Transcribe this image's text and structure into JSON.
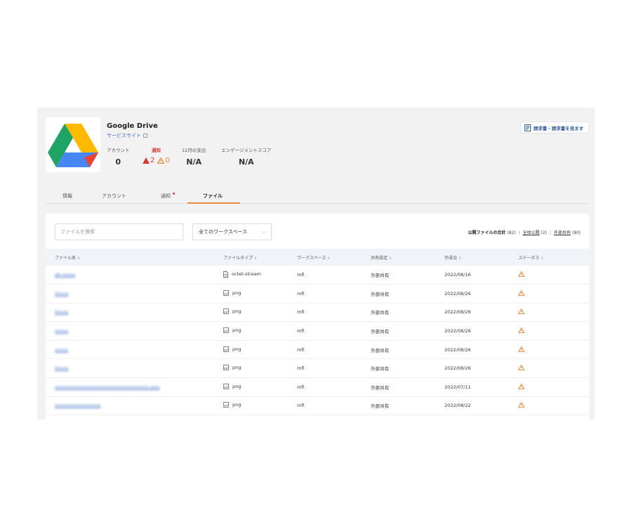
{
  "app": {
    "title": "Google Drive",
    "service_link": "サービスサイト",
    "logo": "google-drive-logo",
    "report_button": "請求書・請求書を見ます"
  },
  "stats": [
    {
      "label": "アカウント",
      "value": "0"
    },
    {
      "label": "通知",
      "alert_high": "2",
      "alert_warn": "0"
    },
    {
      "label": "12月の支出",
      "value": "N/A"
    },
    {
      "label": "エンゲージメントスコア",
      "value": "N/A"
    }
  ],
  "tabs": [
    {
      "label": "情報"
    },
    {
      "label": "アカウント"
    },
    {
      "label": "通知"
    },
    {
      "label": "ファイル",
      "active": true
    }
  ],
  "filters": {
    "search_placeholder": "ファイルを検索",
    "workspace_select": "全てのワークスペース"
  },
  "summary": {
    "label": "公開ファイルの合計",
    "total": "(82)",
    "public_label": "全体公開",
    "public_count": "(2)",
    "external_label": "外部共有",
    "external_count": "(80)"
  },
  "table": {
    "columns": [
      "ファイル名",
      "ファイルタイプ",
      "ワークスペース",
      "共有設定",
      "作成日",
      "ステータス"
    ],
    "rows": [
      {
        "name": "ab.xxxxx",
        "type": "octet-stream",
        "icon": "document-icon",
        "workspace": "mfi",
        "sharing": "外部共有",
        "date": "2022/08/16"
      },
      {
        "name": "Sxxxx",
        "type": "png",
        "icon": "image-icon",
        "workspace": "mfi",
        "sharing": "外部共有",
        "date": "2022/08/26"
      },
      {
        "name": "Sxxxx",
        "type": "png",
        "icon": "image-icon",
        "workspace": "mfi",
        "sharing": "外部共有",
        "date": "2022/08/26"
      },
      {
        "name": "xxxxx",
        "type": "png",
        "icon": "image-icon",
        "workspace": "mfi",
        "sharing": "外部共有",
        "date": "2022/08/26"
      },
      {
        "name": "xxxxx",
        "type": "png",
        "icon": "image-icon",
        "workspace": "mfi",
        "sharing": "外部共有",
        "date": "2022/08/26"
      },
      {
        "name": "Sxxxx",
        "type": "png",
        "icon": "image-icon",
        "workspace": "mfi",
        "sharing": "外部共有",
        "date": "2022/08/26"
      },
      {
        "name": "xxxxxxxxxxxxxxxxxxxxxxxxxxxxxxxxxxx.png",
        "type": "png",
        "icon": "image-icon",
        "workspace": "mfi",
        "sharing": "外部共有",
        "date": "2022/07/11"
      },
      {
        "name": "xxxxxxxxxxxxxxxxx",
        "type": "png",
        "icon": "image-icon",
        "workspace": "mfi",
        "sharing": "外部共有",
        "date": "2022/08/22"
      }
    ]
  },
  "colors": {
    "accent": "#e8893d",
    "link": "#3b6fc4",
    "alert": "#d63a2f",
    "warning": "#e58a3c"
  }
}
